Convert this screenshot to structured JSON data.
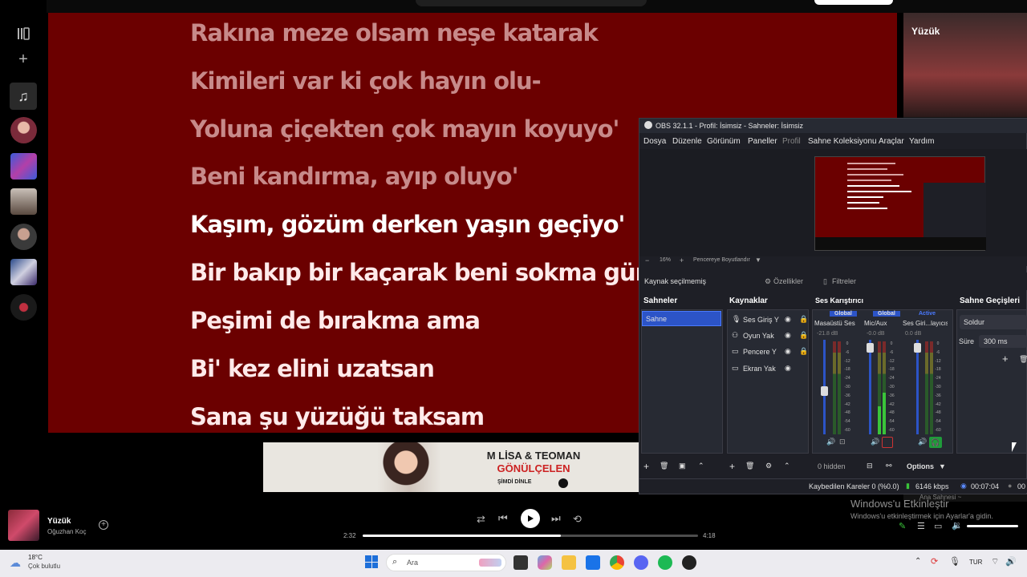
{
  "lyrics": {
    "past": [
      "Rakına meze olsam neşe katarak",
      "Kimileri var ki çok hayın olu-",
      "Yoluna çiçekten çok mayın koyuyo'",
      "Beni kandırma, ayıp oluyo'"
    ],
    "current": "Kaşım, gözüm derken yaşın geçiyo'",
    "upcoming": [
      "Bir bakıp bir kaçarak beni sokma günah",
      "Peşimi de bırakma ama",
      "Bi' kez elini uzatsan",
      "Sana şu yüzüğü taksam"
    ]
  },
  "right_panel": {
    "title": "Yüzük"
  },
  "ad": {
    "line1": "M LİSA & TEOMAN",
    "line2": "GÖNÜLÇELEN",
    "line3": "ŞİMDİ DİNLE"
  },
  "obs": {
    "title": "OBS 32.1.1 - Profil: İsimsiz - Sahneler: İsimsiz",
    "menu": [
      "Dosya",
      "Düzenle",
      "Görünüm",
      "Paneller",
      "Profil",
      "Sahne Koleksiyonu",
      "Araçlar",
      "Yardım"
    ],
    "zoom": "16%",
    "fit": "Pencereye Boyutlandır",
    "no_source": "Kaynak seçilmemiş",
    "properties": "Özellikler",
    "filters": "Filtreler",
    "scenes_title": "Sahneler",
    "scene": "Sahne",
    "sources_title": "Kaynaklar",
    "sources": [
      "Ses Giriş Y",
      "Oyun Yak",
      "Pencere Y",
      "Ekran Yak"
    ],
    "mixer_title": "Ses Karıştırıcı",
    "mixer_tags": [
      "Global",
      "Global",
      "Active"
    ],
    "mixer_channels": [
      "Masaüstü Ses",
      "Mic/Aux",
      "Ses Giri...layıcısı"
    ],
    "mixer_db": [
      "-21.8 dB",
      "-0.0 dB",
      "0.0 dB"
    ],
    "mixer_scale": [
      "0",
      "-6",
      "-12",
      "-18",
      "-24",
      "-30",
      "-36",
      "-42",
      "-48",
      "-54",
      "-60"
    ],
    "hidden": "0 hidden",
    "options": "Options",
    "transitions_title": "Sahne Geçişleri",
    "transition": "Soldur",
    "duration_label": "Süre",
    "duration_value": "300 ms",
    "status_dropped": "Kaybedilen Kareler 0 (%0.0)",
    "status_bitrate": "6146 kbps",
    "status_time": "00:07:04",
    "status_cut": "00"
  },
  "player": {
    "title": "Yüzük",
    "artist": "Oğuzhan Koç",
    "elapsed": "2:32",
    "total": "4:18",
    "progress": 0.59
  },
  "watermark": {
    "overlay": "Ana Sahnesi ~",
    "title": "Windows'u Etkinleştir",
    "sub": "Windows'u etkinleştirmek için Ayarlar'a gidin."
  },
  "taskbar": {
    "weather_temp": "18°C",
    "weather_desc": "Çok bulutlu",
    "search": "Ara",
    "lang": "TUR"
  }
}
